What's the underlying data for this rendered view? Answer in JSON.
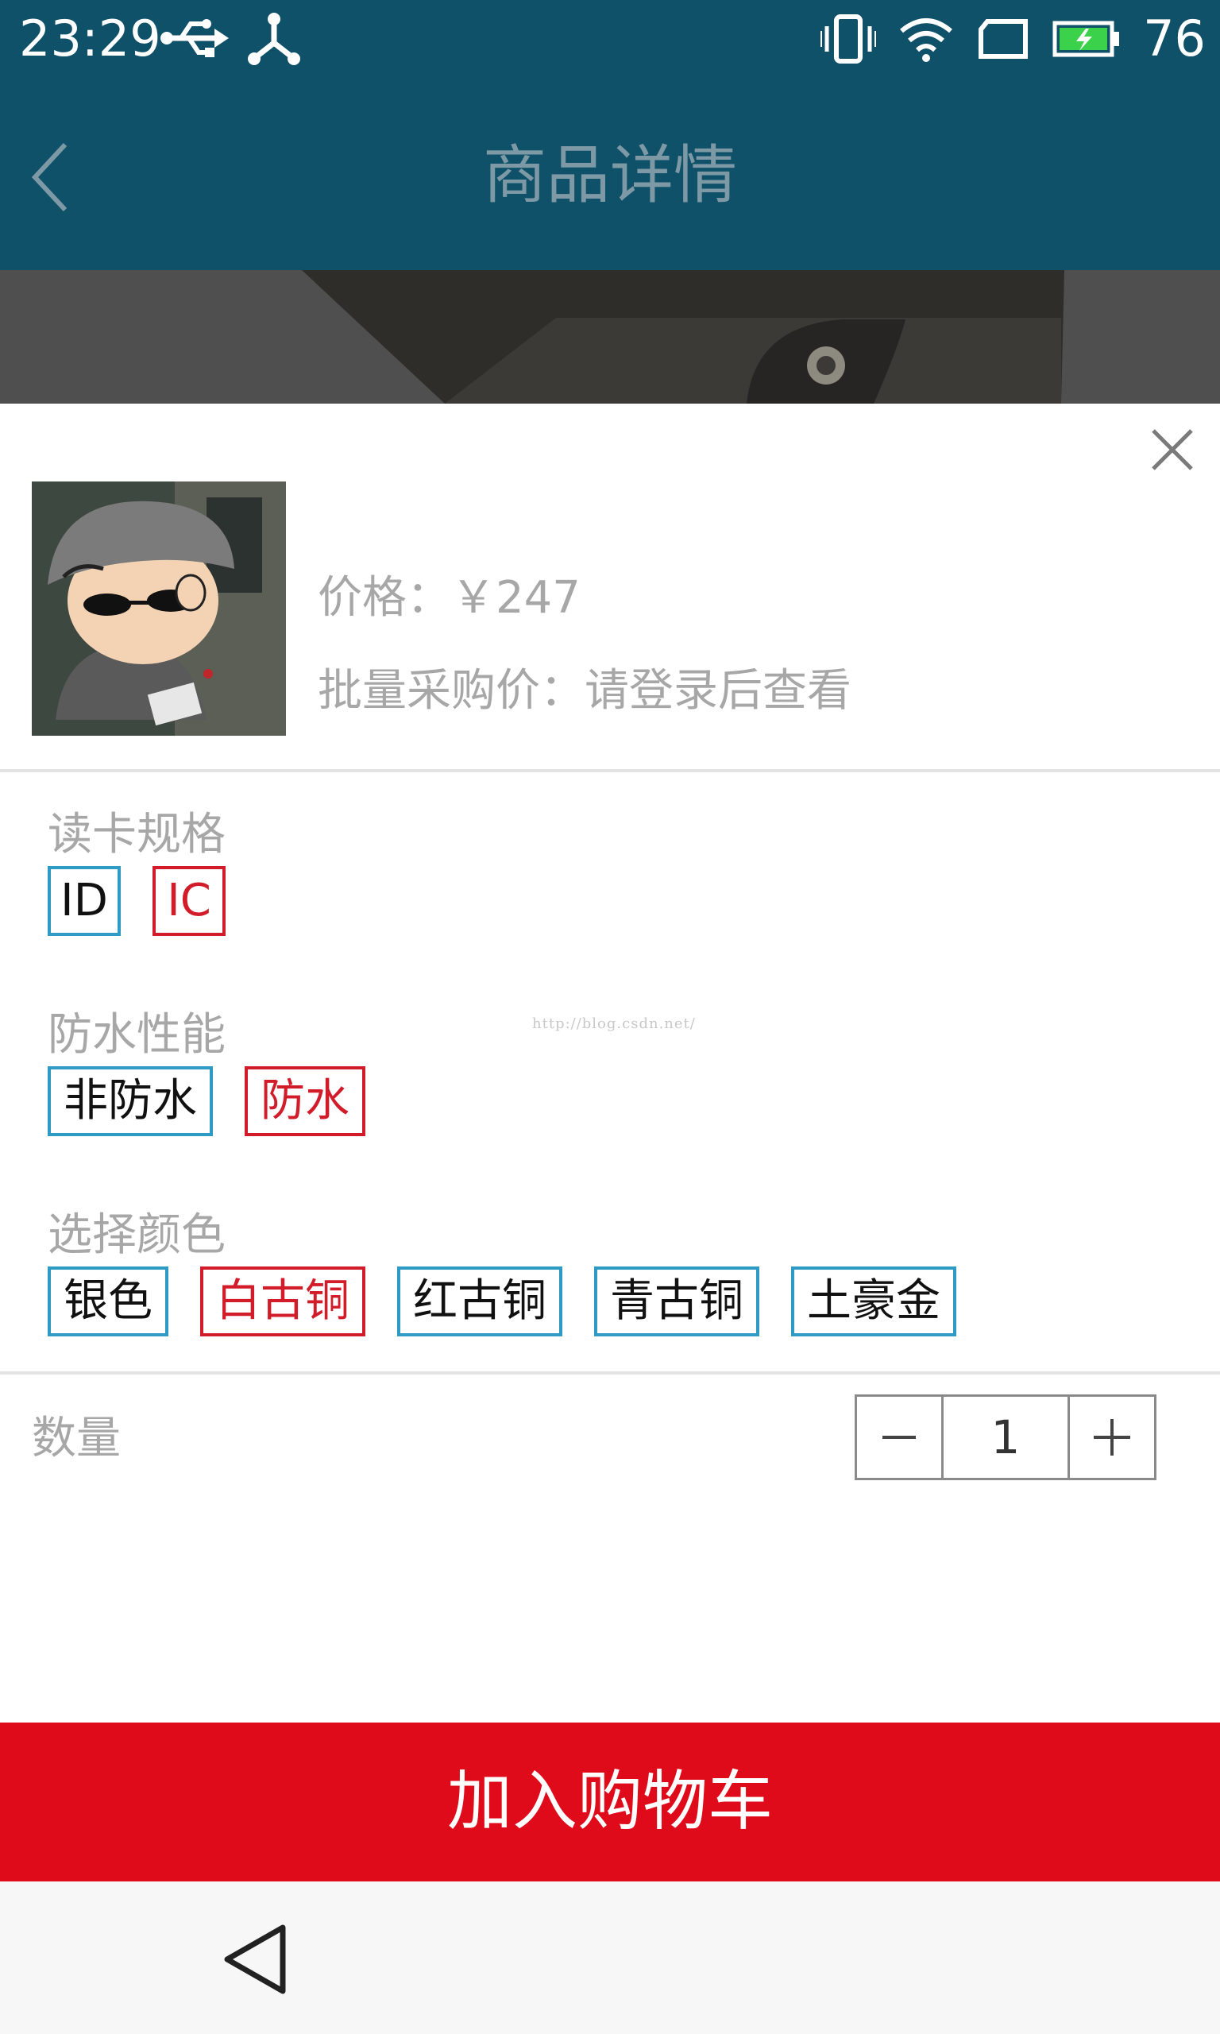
{
  "status_bar": {
    "time": "23:29",
    "battery_level": "76",
    "icons": [
      "usb-icon",
      "share-icon",
      "vibrate-icon",
      "wifi-icon",
      "sim-icon",
      "battery-charging-icon"
    ]
  },
  "header": {
    "title": "商品详情",
    "back_icon": "chevron-left-icon"
  },
  "sheet": {
    "close_icon": "close-icon",
    "price_label": "价格：￥247",
    "bulk_price_label": "批量采购价：请登录后查看",
    "specs": [
      {
        "title": "读卡规格",
        "options": [
          "ID",
          "IC"
        ],
        "selected": "IC"
      },
      {
        "title": "防水性能",
        "options": [
          "非防水",
          "防水"
        ],
        "selected": "防水"
      },
      {
        "title": "选择颜色",
        "options": [
          "银色",
          "白古铜",
          "红古铜",
          "青古铜",
          "土豪金"
        ],
        "selected": "白古铜"
      }
    ],
    "watermark": "http://blog.csdn.net/",
    "quantity": {
      "label": "数量",
      "value": "1",
      "decrement_icon": "minus-icon",
      "increment_icon": "plus-icon"
    },
    "add_to_cart_label": "加入购物车"
  },
  "nav_bar": {
    "back_icon": "triangle-back-icon"
  },
  "colors": {
    "header_bg": "#0f5168",
    "accent_blue": "#2e9bc4",
    "accent_red": "#d21c2a",
    "cart_button": "#e00b1a"
  }
}
